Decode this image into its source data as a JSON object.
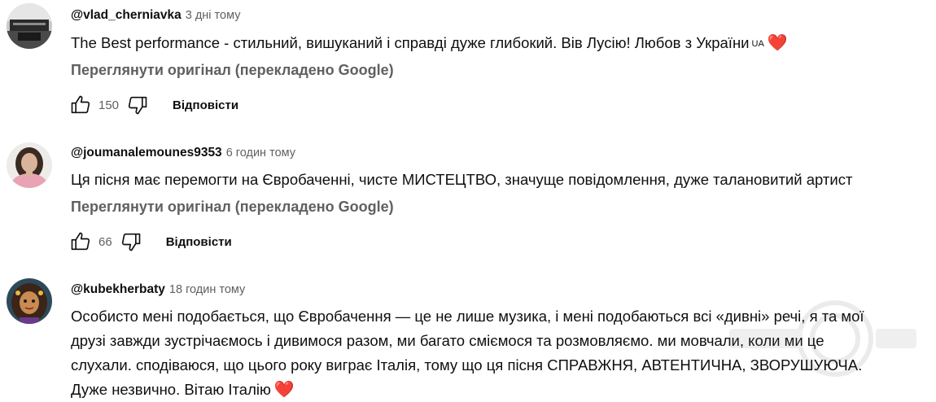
{
  "comments": [
    {
      "author": "@vlad_cherniavka",
      "time": "3 дні тому",
      "text_lines": [
        "The Best performance - стильний, вишуканий і справді дуже глибокий. Вів Лусію! Любов з України"
      ],
      "flag_text": "UA",
      "emoji": "❤️",
      "translate_link": "Переглянути оригінал (перекладено Google)",
      "likes": "150",
      "reply_label": "Відповісти"
    },
    {
      "author": "@joumanalemounes9353",
      "time": "6 годин тому",
      "text_lines": [
        "Ця пісня має перемогти на Євробаченні, чисте МИСТЕЦТВО, значуще повідомлення, дуже талановитий артист"
      ],
      "translate_link": "Переглянути оригінал (перекладено Google)",
      "likes": "66",
      "reply_label": "Відповісти"
    },
    {
      "author": "@kubekherbaty",
      "time": "18 годин тому",
      "text_lines": [
        "Особисто мені подобається, що Євробачення — це не лише музика, і мені подобаються всі «дивні» речі, я та мої",
        "друзі завжди зустрічаємось і дивимося разом, ми багато сміємося та розмовляємо. ми мовчали, коли ми це",
        "слухали. сподіваюся, що цього року виграє Італія, тому що ця пісня СПРАВЖНЯ, АВТЕНТИЧНА, ЗВОРУШУЮЧА.",
        "Дуже незвично. Вітаю Італію"
      ],
      "emoji": "❤️"
    }
  ],
  "icons": {
    "like": "thumb-up-icon",
    "dislike": "thumb-down-icon",
    "heart": "heart-emoji"
  },
  "colors": {
    "text": "#0f0f0f",
    "secondary": "#606060",
    "heart": "#e0262c",
    "background": "#ffffff"
  }
}
